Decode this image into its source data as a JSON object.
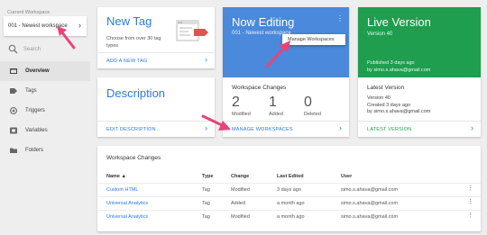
{
  "sidebar": {
    "workspace_label": "Current Workspace",
    "workspace_name": "001 - Newest workspace",
    "search_placeholder": "Search",
    "items": [
      {
        "label": "Overview",
        "icon": "overview-icon"
      },
      {
        "label": "Tags",
        "icon": "tag-icon"
      },
      {
        "label": "Triggers",
        "icon": "trigger-icon"
      },
      {
        "label": "Variables",
        "icon": "variables-icon"
      },
      {
        "label": "Folders",
        "icon": "folder-icon"
      }
    ]
  },
  "new_tag": {
    "title": "New Tag",
    "description": "Choose from over 30 tag types",
    "link": "ADD A NEW TAG"
  },
  "now_editing": {
    "title": "Now Editing",
    "workspace": "001 - Newest workspace",
    "menu_item": "Manage Workspaces",
    "changes_title": "Workspace Changes",
    "stats": [
      {
        "value": "2",
        "label": "Modified"
      },
      {
        "value": "1",
        "label": "Added"
      },
      {
        "value": "0",
        "label": "Deleted"
      }
    ],
    "link": "MANAGE WORKSPACES"
  },
  "live_version": {
    "title": "Live Version",
    "version": "Version 40",
    "published": "Published 3 days ago",
    "published_by": "by simo.s.ahava@gmail.com",
    "latest_title": "Latest Version",
    "latest_version": "Version 40",
    "latest_when": "Created 3 days ago",
    "latest_by": "by simo.s.ahava@gmail.com",
    "link": "LATEST VERSION"
  },
  "description": {
    "title": "Description",
    "link": "EDIT DESCRIPTION"
  },
  "changes_table": {
    "title": "Workspace Changes",
    "columns": [
      "Name ▲",
      "Type",
      "Change",
      "Last Edited",
      "User"
    ],
    "rows": [
      {
        "name": "Custom HTML",
        "type": "Tag",
        "change": "Modified",
        "edited": "3 days ago",
        "user": "simo.s.ahava@gmail.com"
      },
      {
        "name": "Universal Analytics",
        "type": "Tag",
        "change": "Added",
        "edited": "a month ago",
        "user": "simo.s.ahava@gmail.com"
      },
      {
        "name": "Universal Analytics",
        "type": "Tag",
        "change": "Modified",
        "edited": "a month ago",
        "user": "simo.s.ahava@gmail.com"
      }
    ]
  },
  "colors": {
    "accent_blue": "#4a89dc",
    "link_blue": "#2a7ae2",
    "live_green": "#1e9e4e",
    "annotation_pink": "#e8437a"
  }
}
